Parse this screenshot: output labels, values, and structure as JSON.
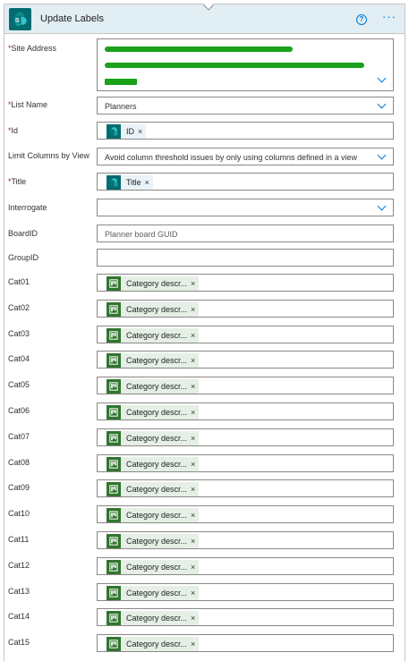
{
  "card": {
    "title": "Update Labels",
    "help_symbol": "?",
    "more_symbol": "···"
  },
  "fields": {
    "site_address": {
      "label": "Site Address",
      "required": "*"
    },
    "list_name": {
      "label": "List Name",
      "required": "*",
      "value": "Planners"
    },
    "id": {
      "label": "Id",
      "required": "*",
      "token": "ID"
    },
    "limit_columns": {
      "label": "Limit Columns by View",
      "value": "Avoid column threshold issues by only using columns defined in a view"
    },
    "title": {
      "label": "Title",
      "required": "*",
      "token": "Title"
    },
    "interrogate": {
      "label": "Interrogate"
    },
    "boardid": {
      "label": "BoardID",
      "placeholder": "Planner board GUID"
    },
    "groupid": {
      "label": "GroupID"
    }
  },
  "categories": [
    {
      "label": "Cat01",
      "token": "Category descr..."
    },
    {
      "label": "Cat02",
      "token": "Category descr..."
    },
    {
      "label": "Cat03",
      "token": "Category descr..."
    },
    {
      "label": "Cat04",
      "token": "Category descr..."
    },
    {
      "label": "Cat05",
      "token": "Category descr..."
    },
    {
      "label": "Cat06",
      "token": "Category descr..."
    },
    {
      "label": "Cat07",
      "token": "Category descr..."
    },
    {
      "label": "Cat08",
      "token": "Category descr..."
    },
    {
      "label": "Cat09",
      "token": "Category descr..."
    },
    {
      "label": "Cat10",
      "token": "Category descr..."
    },
    {
      "label": "Cat11",
      "token": "Category descr..."
    },
    {
      "label": "Cat12",
      "token": "Category descr..."
    },
    {
      "label": "Cat13",
      "token": "Category descr..."
    },
    {
      "label": "Cat14",
      "token": "Category descr..."
    },
    {
      "label": "Cat15",
      "token": "Category descr..."
    }
  ],
  "token_close": "×",
  "colors": {
    "header_bg": "#e1eef3",
    "sharepoint_teal": "#036c70",
    "planner_green": "#31752f",
    "accent_blue": "#0078d4",
    "required_red": "#a4262c",
    "redaction_green": "#1aa11a"
  },
  "icons": {
    "header": "sharepoint-logo-icon",
    "token_sharepoint": "sharepoint-token-icon",
    "token_planner": "planner-token-icon",
    "dropdown": "chevron-down-icon"
  }
}
